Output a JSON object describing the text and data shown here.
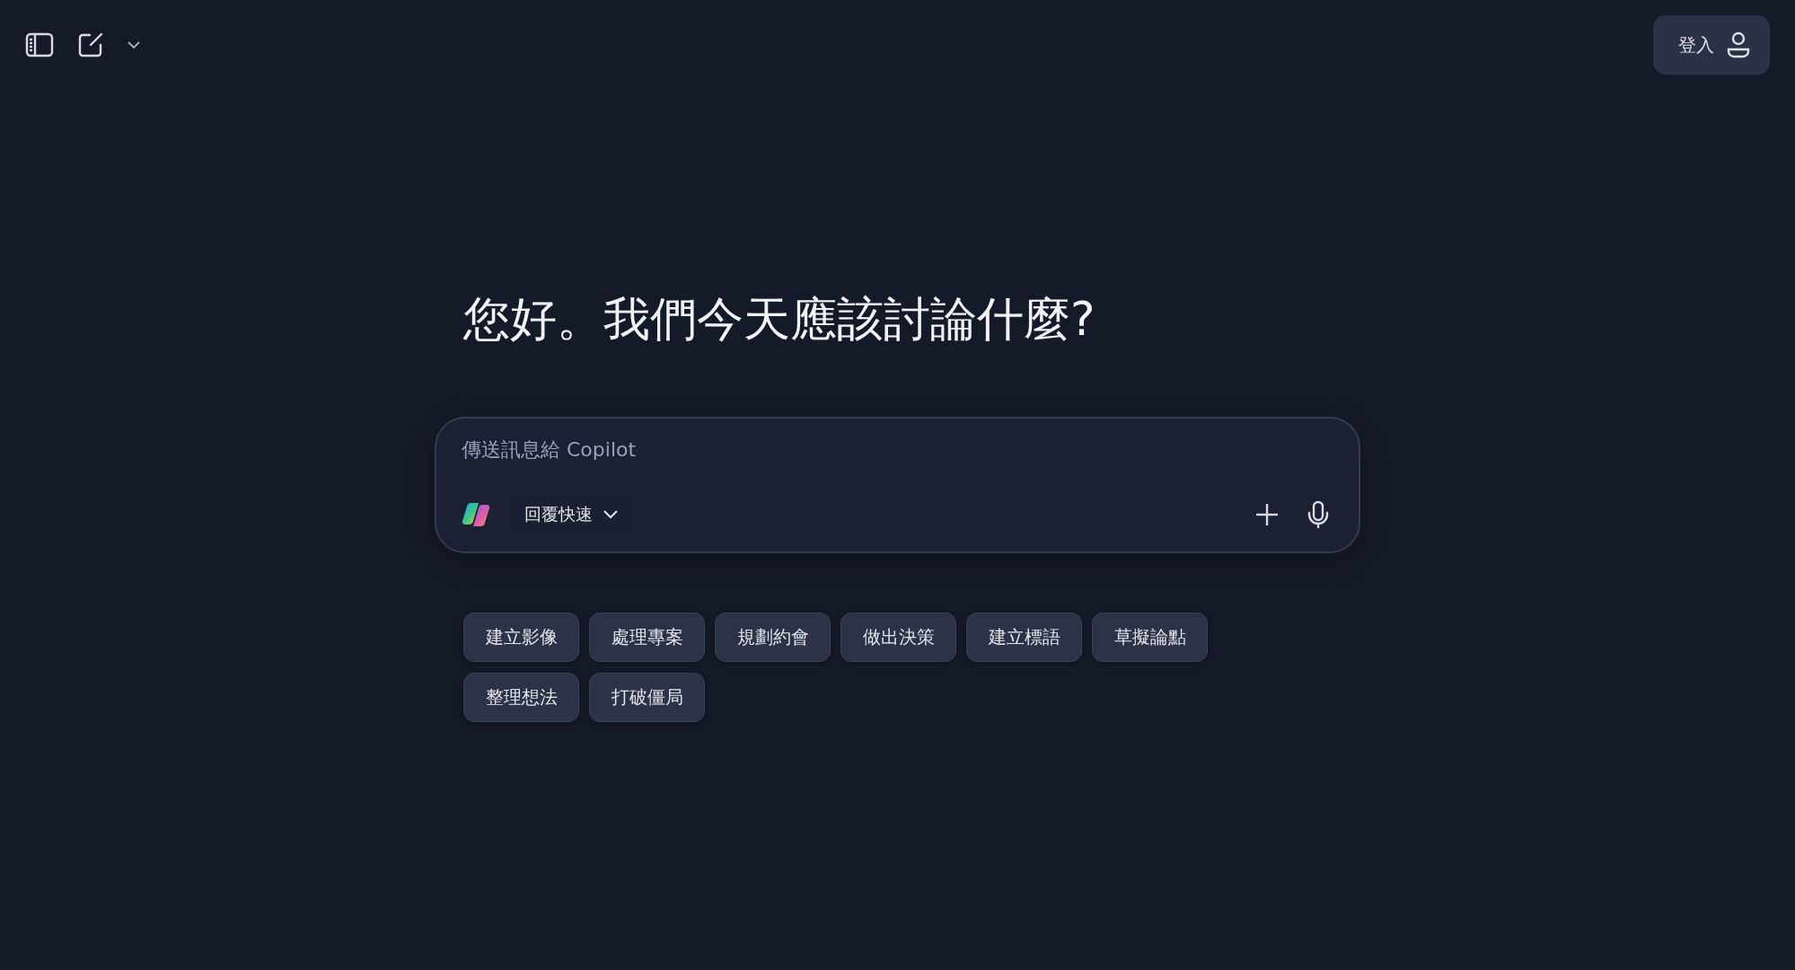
{
  "toolbar": {
    "sign_in": "登入"
  },
  "greeting": "您好。我們今天應該討論什麼?",
  "composer": {
    "placeholder": "傳送訊息給 Copilot",
    "mode": "回覆快速"
  },
  "suggestions": [
    {
      "label": "建立影像"
    },
    {
      "label": "處理專案"
    },
    {
      "label": "規劃約會"
    },
    {
      "label": "做出決策"
    },
    {
      "label": "建立標語"
    },
    {
      "label": "草擬論點"
    },
    {
      "label": "整理想法"
    },
    {
      "label": "打破僵局"
    }
  ]
}
